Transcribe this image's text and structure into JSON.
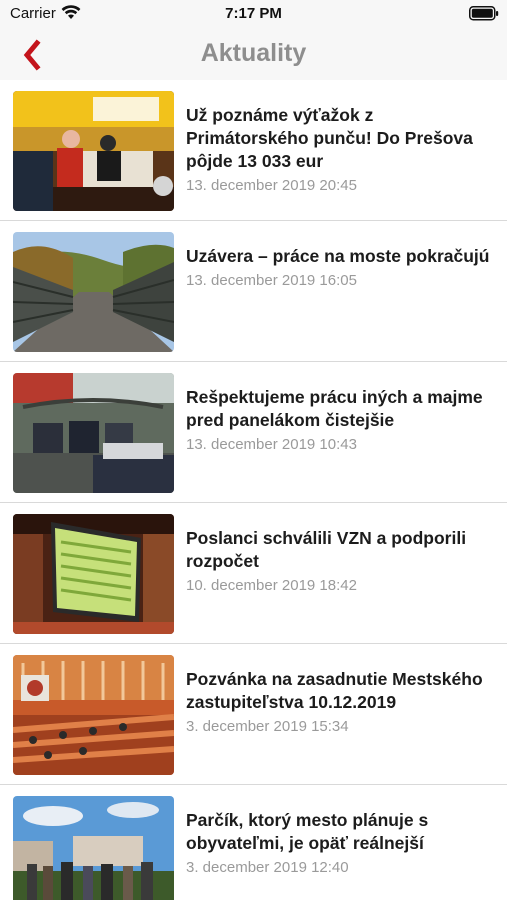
{
  "status_bar": {
    "carrier": "Carrier",
    "time": "7:17 PM",
    "wifi_icon": "wifi-icon",
    "battery_icon": "battery-icon"
  },
  "nav": {
    "title": "Aktuality",
    "back_icon": "chevron-left-icon",
    "accent_color": "#c4141b"
  },
  "news": [
    {
      "title": "Už poznáme výťažok z Primátorského punču! Do Prešova pôjde 13 033 eur",
      "date": "13. december 2019 20:45",
      "thumb": "christmas-market-stall"
    },
    {
      "title": "Uzávera – práce na moste pokračujú",
      "date": "13. december 2019 16:05",
      "thumb": "steel-bridge"
    },
    {
      "title": "Rešpektujeme prácu iných a majme pred panelákom čistejšie",
      "date": "13. december 2019 10:43",
      "thumb": "garbage-bins"
    },
    {
      "title": "Poslanci schválili VZN a podporili rozpočet",
      "date": "10. december 2019 18:42",
      "thumb": "voting-screen"
    },
    {
      "title": "Pozvánka na zasadnutie Mestského zastupiteľstva 10.12.2019",
      "date": "3. december 2019 15:34",
      "thumb": "council-hall"
    },
    {
      "title": "Parčík, ktorý mesto plánuje s obyvateľmi, je opäť reálnejší",
      "date": "3. december 2019 12:40",
      "thumb": "people-in-park"
    }
  ]
}
